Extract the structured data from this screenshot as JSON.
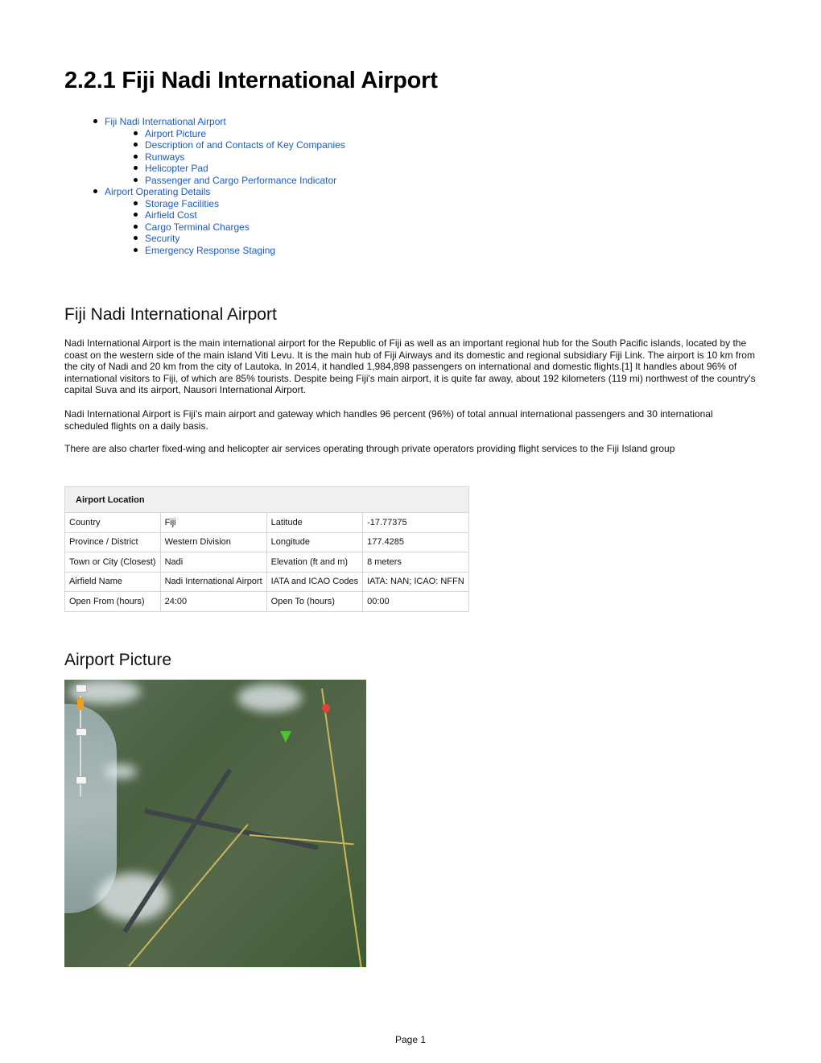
{
  "page_title": "2.2.1 Fiji Nadi International Airport",
  "toc": [
    {
      "level": 1,
      "label": "Fiji Nadi International Airport"
    },
    {
      "level": 2,
      "label": "Airport Picture"
    },
    {
      "level": 2,
      "label": "Description of and Contacts of Key Companies"
    },
    {
      "level": 2,
      "label": "Runways"
    },
    {
      "level": 2,
      "label": "Helicopter Pad"
    },
    {
      "level": 2,
      "label": "Passenger and Cargo Performance Indicator"
    },
    {
      "level": 1,
      "label": "Airport Operating Details"
    },
    {
      "level": 2,
      "label": "Storage Facilities"
    },
    {
      "level": 2,
      "label": "Airfield Cost"
    },
    {
      "level": 2,
      "label": "Cargo Terminal Charges"
    },
    {
      "level": 2,
      "label": "Security"
    },
    {
      "level": 2,
      "label": "Emergency Response Staging"
    }
  ],
  "section1": {
    "heading": "Fiji Nadi International Airport",
    "paragraphs": [
      "Nadi International Airport is the main international airport for the Republic of Fiji as well as an important regional hub for the South Pacific islands, located by the coast on the western side of the main island Viti Levu. It is the main hub of Fiji Airways and its domestic and regional subsidiary Fiji Link. The airport is 10 km from the city of Nadi and 20 km from the city of Lautoka. In 2014, it handled 1,984,898 passengers on international and domestic flights.[1] It handles about 96% of international visitors to Fiji, of which are 85% tourists. Despite being Fiji's main airport, it is quite far away, about 192 kilometers (119 mi) northwest of the country's capital Suva and its airport, Nausori International Airport.",
      "Nadi International Airport is Fiji’s main airport and gateway which handles 96 percent (96%) of total annual international passengers and 30 international scheduled flights on a daily basis.",
      "There are also charter fixed-wing and helicopter air services operating through private operators providing flight services to the Fiji Island group"
    ]
  },
  "location_table": {
    "header": "Airport Location",
    "rows": [
      [
        "Country",
        "Fiji",
        "Latitude",
        "-17.77375"
      ],
      [
        "Province / District",
        "Western Division",
        "Longitude",
        "177.4285"
      ],
      [
        "Town or City (Closest)",
        "Nadi",
        "Elevation (ft and m)",
        "8 meters"
      ],
      [
        "Airfield Name",
        "Nadi International Airport",
        "IATA and ICAO Codes",
        "IATA: NAN; ICAO: NFFN"
      ],
      [
        "Open From (hours)",
        "24:00",
        "Open To (hours)",
        "00:00"
      ]
    ]
  },
  "section2": {
    "heading": "Airport Picture",
    "image_alt": "Satellite map of Nadi International Airport"
  },
  "footer": {
    "page_label": "Page 1"
  }
}
